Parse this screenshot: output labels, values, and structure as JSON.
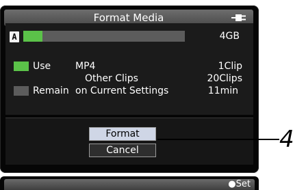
{
  "window": {
    "title": "Format Media",
    "icon": "power-plug-icon"
  },
  "media": {
    "slot_label": "A",
    "capacity": "4GB",
    "used_fraction": 0.12
  },
  "legend": {
    "use_label": "Use",
    "use_color": "#5bc249",
    "remain_label": "Remain",
    "remain_color": "#5c5c5c"
  },
  "rows": [
    {
      "name": "MP4",
      "value": "1Clip"
    },
    {
      "name": "Other Clips",
      "value": "20Clips"
    },
    {
      "name": "on Current Settings",
      "value": "11min"
    }
  ],
  "buttons": {
    "format_label": "Format",
    "cancel_label": "Cancel"
  },
  "footer": {
    "set_label": "●Set"
  },
  "callout": {
    "number": "4"
  }
}
